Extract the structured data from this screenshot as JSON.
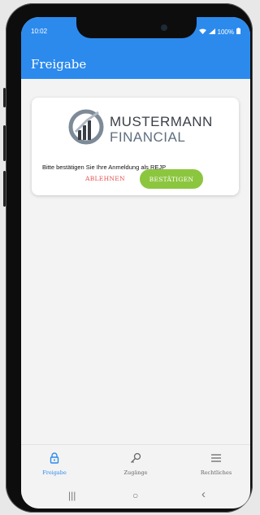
{
  "status_bar": {
    "time": "10:02",
    "battery": "100%"
  },
  "appbar": {
    "title": "Freigabe"
  },
  "card": {
    "logo_line1": "MUSTERMANN",
    "logo_line2": "FINANCIAL",
    "prompt_text": "Bitte bestätigen Sie Ihre Anmeldung als REJP",
    "reject_label": "ABLEHNEN",
    "confirm_label": "BESTÄTIGEN"
  },
  "bottom_nav": {
    "items": [
      {
        "label": "Freigabe",
        "icon": "lock-icon",
        "active": true
      },
      {
        "label": "Zugänge",
        "icon": "key-icon",
        "active": false
      },
      {
        "label": "Rechtliches",
        "icon": "menu-icon",
        "active": false
      }
    ]
  },
  "system_nav": {
    "recent": "|||",
    "home": "○",
    "back": "‹"
  },
  "colors": {
    "primary": "#2c8aed",
    "accept": "#8cc63f",
    "reject": "#e4524f"
  }
}
